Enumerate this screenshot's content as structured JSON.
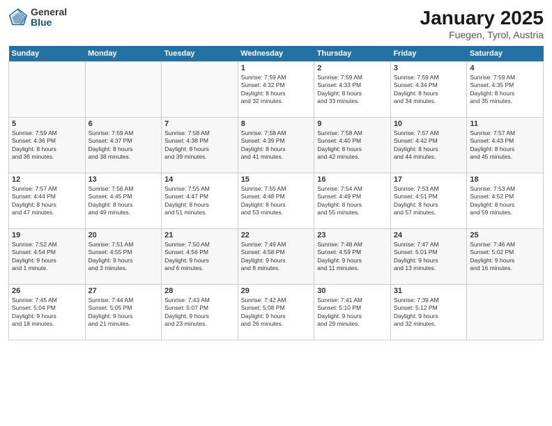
{
  "header": {
    "logo_general": "General",
    "logo_blue": "Blue",
    "title": "January 2025",
    "location": "Fuegen, Tyrol, Austria"
  },
  "columns": [
    "Sunday",
    "Monday",
    "Tuesday",
    "Wednesday",
    "Thursday",
    "Friday",
    "Saturday"
  ],
  "weeks": [
    [
      {
        "day": "",
        "content": ""
      },
      {
        "day": "",
        "content": ""
      },
      {
        "day": "",
        "content": ""
      },
      {
        "day": "1",
        "content": "Sunrise: 7:59 AM\nSunset: 4:32 PM\nDaylight: 8 hours\nand 32 minutes."
      },
      {
        "day": "2",
        "content": "Sunrise: 7:59 AM\nSunset: 4:33 PM\nDaylight: 8 hours\nand 33 minutes."
      },
      {
        "day": "3",
        "content": "Sunrise: 7:59 AM\nSunset: 4:34 PM\nDaylight: 8 hours\nand 34 minutes."
      },
      {
        "day": "4",
        "content": "Sunrise: 7:59 AM\nSunset: 4:35 PM\nDaylight: 8 hours\nand 35 minutes."
      }
    ],
    [
      {
        "day": "5",
        "content": "Sunrise: 7:59 AM\nSunset: 4:36 PM\nDaylight: 8 hours\nand 36 minutes."
      },
      {
        "day": "6",
        "content": "Sunrise: 7:59 AM\nSunset: 4:37 PM\nDaylight: 8 hours\nand 38 minutes."
      },
      {
        "day": "7",
        "content": "Sunrise: 7:58 AM\nSunset: 4:38 PM\nDaylight: 8 hours\nand 39 minutes."
      },
      {
        "day": "8",
        "content": "Sunrise: 7:58 AM\nSunset: 4:39 PM\nDaylight: 8 hours\nand 41 minutes."
      },
      {
        "day": "9",
        "content": "Sunrise: 7:58 AM\nSunset: 4:40 PM\nDaylight: 8 hours\nand 42 minutes."
      },
      {
        "day": "10",
        "content": "Sunrise: 7:57 AM\nSunset: 4:42 PM\nDaylight: 8 hours\nand 44 minutes."
      },
      {
        "day": "11",
        "content": "Sunrise: 7:57 AM\nSunset: 4:43 PM\nDaylight: 8 hours\nand 45 minutes."
      }
    ],
    [
      {
        "day": "12",
        "content": "Sunrise: 7:57 AM\nSunset: 4:44 PM\nDaylight: 8 hours\nand 47 minutes."
      },
      {
        "day": "13",
        "content": "Sunrise: 7:56 AM\nSunset: 4:45 PM\nDaylight: 8 hours\nand 49 minutes."
      },
      {
        "day": "14",
        "content": "Sunrise: 7:55 AM\nSunset: 4:47 PM\nDaylight: 8 hours\nand 51 minutes."
      },
      {
        "day": "15",
        "content": "Sunrise: 7:55 AM\nSunset: 4:48 PM\nDaylight: 8 hours\nand 53 minutes."
      },
      {
        "day": "16",
        "content": "Sunrise: 7:54 AM\nSunset: 4:49 PM\nDaylight: 8 hours\nand 55 minutes."
      },
      {
        "day": "17",
        "content": "Sunrise: 7:53 AM\nSunset: 4:51 PM\nDaylight: 8 hours\nand 57 minutes."
      },
      {
        "day": "18",
        "content": "Sunrise: 7:53 AM\nSunset: 4:52 PM\nDaylight: 8 hours\nand 59 minutes."
      }
    ],
    [
      {
        "day": "19",
        "content": "Sunrise: 7:52 AM\nSunset: 4:54 PM\nDaylight: 9 hours\nand 1 minute."
      },
      {
        "day": "20",
        "content": "Sunrise: 7:51 AM\nSunset: 4:55 PM\nDaylight: 9 hours\nand 3 minutes."
      },
      {
        "day": "21",
        "content": "Sunrise: 7:50 AM\nSunset: 4:56 PM\nDaylight: 9 hours\nand 6 minutes."
      },
      {
        "day": "22",
        "content": "Sunrise: 7:49 AM\nSunset: 4:58 PM\nDaylight: 9 hours\nand 8 minutes."
      },
      {
        "day": "23",
        "content": "Sunrise: 7:48 AM\nSunset: 4:59 PM\nDaylight: 9 hours\nand 11 minutes."
      },
      {
        "day": "24",
        "content": "Sunrise: 7:47 AM\nSunset: 5:01 PM\nDaylight: 9 hours\nand 13 minutes."
      },
      {
        "day": "25",
        "content": "Sunrise: 7:46 AM\nSunset: 5:02 PM\nDaylight: 9 hours\nand 16 minutes."
      }
    ],
    [
      {
        "day": "26",
        "content": "Sunrise: 7:45 AM\nSunset: 5:04 PM\nDaylight: 9 hours\nand 18 minutes."
      },
      {
        "day": "27",
        "content": "Sunrise: 7:44 AM\nSunset: 5:05 PM\nDaylight: 9 hours\nand 21 minutes."
      },
      {
        "day": "28",
        "content": "Sunrise: 7:43 AM\nSunset: 5:07 PM\nDaylight: 9 hours\nand 23 minutes."
      },
      {
        "day": "29",
        "content": "Sunrise: 7:42 AM\nSunset: 5:08 PM\nDaylight: 9 hours\nand 26 minutes."
      },
      {
        "day": "30",
        "content": "Sunrise: 7:41 AM\nSunset: 5:10 PM\nDaylight: 9 hours\nand 29 minutes."
      },
      {
        "day": "31",
        "content": "Sunrise: 7:39 AM\nSunset: 5:12 PM\nDaylight: 9 hours\nand 32 minutes."
      },
      {
        "day": "",
        "content": ""
      }
    ]
  ]
}
